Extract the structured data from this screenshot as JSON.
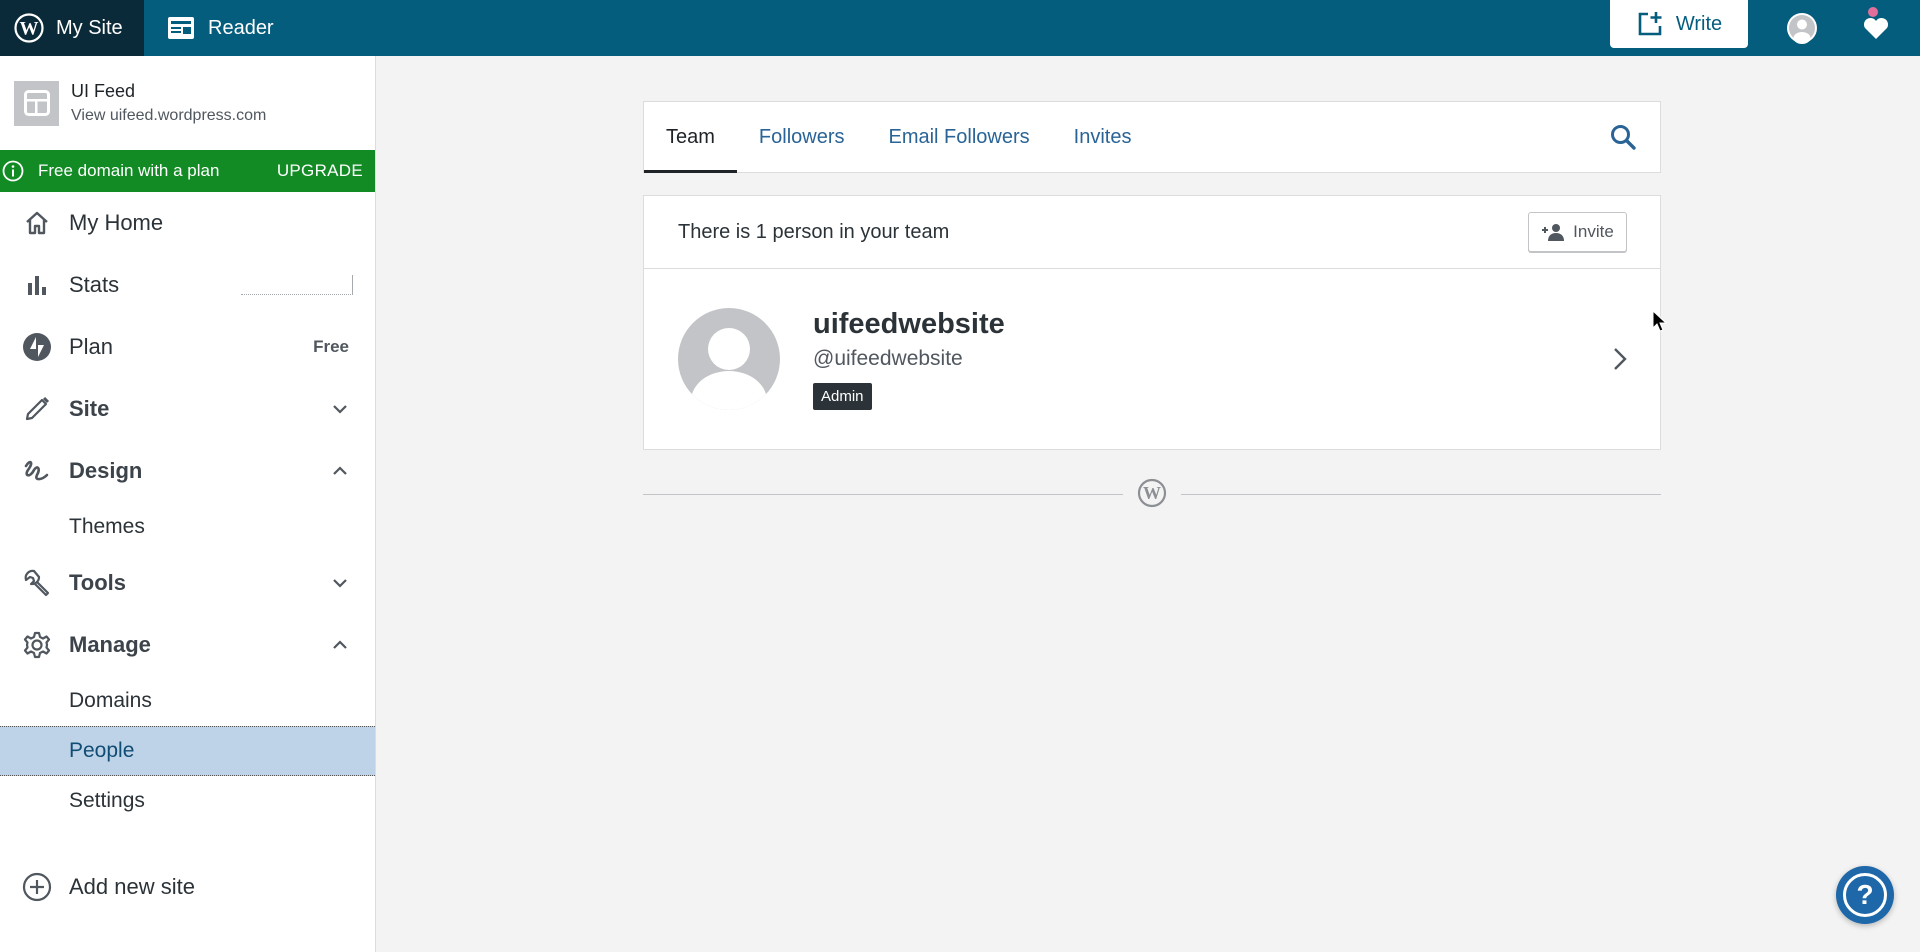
{
  "masterbar": {
    "my_site": "My Site",
    "reader": "Reader",
    "write": "Write",
    "icons": {
      "my_site": "wordpress-logo-icon",
      "reader": "reader-icon",
      "write": "write-icon",
      "avatar": "user-avatar-icon",
      "notifications": "notifications-bell-icon"
    },
    "colors": {
      "bar": "#055d7e",
      "my_site_bg": "#0b2a39",
      "notification_dot": "#e26f9b"
    }
  },
  "sidebar": {
    "site": {
      "name": "UI Feed",
      "url": "View uifeed.wordpress.com"
    },
    "upsell": {
      "text": "Free domain with a plan",
      "button": "UPGRADE",
      "color": "#128b24"
    },
    "items": [
      {
        "label": "My Home",
        "icon": "home-icon"
      },
      {
        "label": "Stats",
        "icon": "stats-icon"
      },
      {
        "label": "Plan",
        "icon": "plan-icon",
        "extra": "Free"
      },
      {
        "label": "Site",
        "icon": "pencil-icon",
        "chevron": "down"
      },
      {
        "label": "Design",
        "icon": "design-icon",
        "chevron": "up",
        "children": [
          "Themes"
        ]
      },
      {
        "label": "Tools",
        "icon": "tools-icon",
        "chevron": "down"
      },
      {
        "label": "Manage",
        "icon": "gear-icon",
        "chevron": "up",
        "children": [
          "Domains",
          "People",
          "Settings"
        ]
      }
    ],
    "selected": "People",
    "add_site": "Add new site"
  },
  "main": {
    "tabs": [
      {
        "label": "Team",
        "active": true
      },
      {
        "label": "Followers",
        "active": false
      },
      {
        "label": "Email Followers",
        "active": false
      },
      {
        "label": "Invites",
        "active": false
      }
    ],
    "team_count": "There is 1 person in your team",
    "invite_button": "Invite",
    "people": [
      {
        "name": "uifeedwebsite",
        "handle": "@uifeedwebsite",
        "role": "Admin"
      }
    ]
  },
  "help": {
    "label": "?"
  }
}
